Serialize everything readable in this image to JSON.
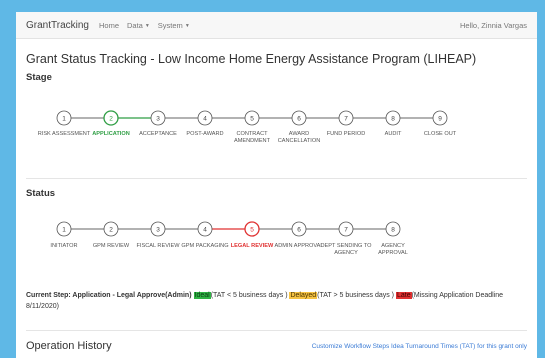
{
  "navbar": {
    "brand": "GrantTracking",
    "home": "Home",
    "data": "Data",
    "system": "System",
    "greeting": "Hello, Zinnia Vargas"
  },
  "page_title": "Grant Status Tracking - Low Income Home Energy Assistance Program (LIHEAP)",
  "stage": {
    "label": "Stage",
    "active_index": 1,
    "steps": [
      {
        "num": "1",
        "label": "RISK ASSESSMENT"
      },
      {
        "num": "2",
        "label": "APPLICATION"
      },
      {
        "num": "3",
        "label": "ACCEPTANCE"
      },
      {
        "num": "4",
        "label": "POST-AWARD"
      },
      {
        "num": "5",
        "label": "CONTRACT AMENDMENT"
      },
      {
        "num": "6",
        "label": "AWARD CANCELLATION"
      },
      {
        "num": "7",
        "label": "FUND PERIOD"
      },
      {
        "num": "8",
        "label": "AUDIT"
      },
      {
        "num": "9",
        "label": "CLOSE OUT"
      }
    ]
  },
  "status": {
    "label": "Status",
    "active_index": 4,
    "steps": [
      {
        "num": "1",
        "label": "INITIATOR"
      },
      {
        "num": "2",
        "label": "GPM REVIEW"
      },
      {
        "num": "3",
        "label": "FISCAL REVIEW"
      },
      {
        "num": "4",
        "label": "GPM PACKAGING"
      },
      {
        "num": "5",
        "label": "LEGAL REVIEW"
      },
      {
        "num": "6",
        "label": "ADMIN APPROVAL"
      },
      {
        "num": "7",
        "label": "DEPT SENDING TO AGENCY"
      },
      {
        "num": "8",
        "label": "AGENCY APPROVAL"
      }
    ]
  },
  "current_step": {
    "prefix": "Current Step: Application - Legal Approve(Admin)",
    "ideal_tag": "Ideal",
    "ideal_text": "(TAT < 5 business days )",
    "delayed_tag": "Delayed",
    "delayed_text": "(TAT > 5 business days )",
    "late_tag": "Late",
    "late_text": "(Missing Application Deadline 8/11/2020)"
  },
  "operation_history": {
    "title": "Operation History",
    "link": "Customize Workflow Steps Idea Turnaround Times (TAT) for this grant only"
  },
  "colors": {
    "background": "#5fb8e6",
    "active_stage": "#2f9e44",
    "active_status": "#e03131",
    "ideal": "#2fb344",
    "delayed": "#f6c343",
    "late": "#e03131",
    "link": "#3a7bd5"
  }
}
